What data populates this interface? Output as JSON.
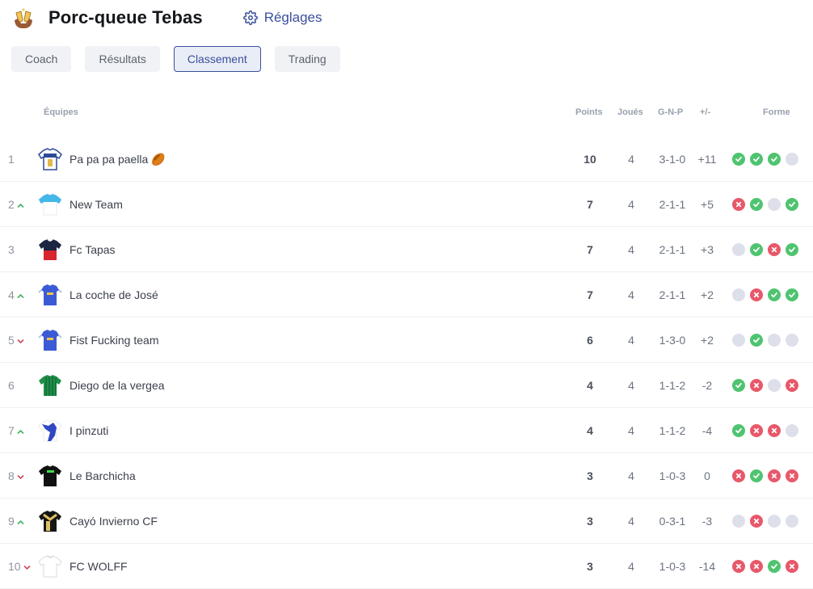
{
  "header": {
    "league_name": "Porc-queue Tebas",
    "settings_label": "Réglages"
  },
  "tabs": [
    {
      "label": "Coach",
      "active": false
    },
    {
      "label": "Résultats",
      "active": false
    },
    {
      "label": "Classement",
      "active": true
    },
    {
      "label": "Trading",
      "active": false
    }
  ],
  "table": {
    "headers": {
      "teams": "Équipes",
      "points": "Points",
      "played": "Joués",
      "gnp": "G-N-P",
      "diff": "+/-",
      "form": "Forme"
    },
    "rows": [
      {
        "rank": "1",
        "trend": "none",
        "team": "Pa pa pa paella 🏉",
        "jersey": "paella",
        "points": "10",
        "played": "4",
        "gnp": "3-1-0",
        "diff": "+11",
        "form": [
          "W",
          "W",
          "W",
          "N"
        ]
      },
      {
        "rank": "2",
        "trend": "up",
        "team": "New Team",
        "jersey": "newteam",
        "points": "7",
        "played": "4",
        "gnp": "2-1-1",
        "diff": "+5",
        "form": [
          "L",
          "W",
          "N",
          "W"
        ]
      },
      {
        "rank": "3",
        "trend": "none",
        "team": "Fc Tapas",
        "jersey": "tapas",
        "points": "7",
        "played": "4",
        "gnp": "2-1-1",
        "diff": "+3",
        "form": [
          "N",
          "W",
          "L",
          "W"
        ]
      },
      {
        "rank": "4",
        "trend": "up",
        "team": "La coche de José",
        "jersey": "blue",
        "points": "7",
        "played": "4",
        "gnp": "2-1-1",
        "diff": "+2",
        "form": [
          "N",
          "L",
          "W",
          "W"
        ]
      },
      {
        "rank": "5",
        "trend": "down",
        "team": "Fist Fucking team",
        "jersey": "blue",
        "points": "6",
        "played": "4",
        "gnp": "1-3-0",
        "diff": "+2",
        "form": [
          "N",
          "W",
          "N",
          "N"
        ]
      },
      {
        "rank": "6",
        "trend": "none",
        "team": "Diego de la vergea",
        "jersey": "green",
        "points": "4",
        "played": "4",
        "gnp": "1-1-2",
        "diff": "-2",
        "form": [
          "W",
          "L",
          "N",
          "L"
        ]
      },
      {
        "rank": "7",
        "trend": "up",
        "team": "I pinzuti",
        "jersey": "pinzuti",
        "points": "4",
        "played": "4",
        "gnp": "1-1-2",
        "diff": "-4",
        "form": [
          "W",
          "L",
          "L",
          "N"
        ]
      },
      {
        "rank": "8",
        "trend": "down",
        "team": "Le Barchicha",
        "jersey": "black",
        "points": "3",
        "played": "4",
        "gnp": "1-0-3",
        "diff": "0",
        "form": [
          "L",
          "W",
          "L",
          "L"
        ]
      },
      {
        "rank": "9",
        "trend": "up",
        "team": "Cayó Invierno CF",
        "jersey": "blackgold",
        "points": "3",
        "played": "4",
        "gnp": "0-3-1",
        "diff": "-3",
        "form": [
          "N",
          "L",
          "N",
          "N"
        ]
      },
      {
        "rank": "10",
        "trend": "down",
        "team": "FC WOLFF",
        "jersey": "white",
        "points": "3",
        "played": "4",
        "gnp": "1-0-3",
        "diff": "-14",
        "form": [
          "L",
          "L",
          "W",
          "L"
        ]
      }
    ]
  },
  "colors": {
    "accent": "#3b4f9c",
    "win": "#4fc470",
    "loss": "#e8586a",
    "neutral": "#dde0ea",
    "trend_up": "#3fb15f",
    "trend_down": "#d6455a"
  }
}
